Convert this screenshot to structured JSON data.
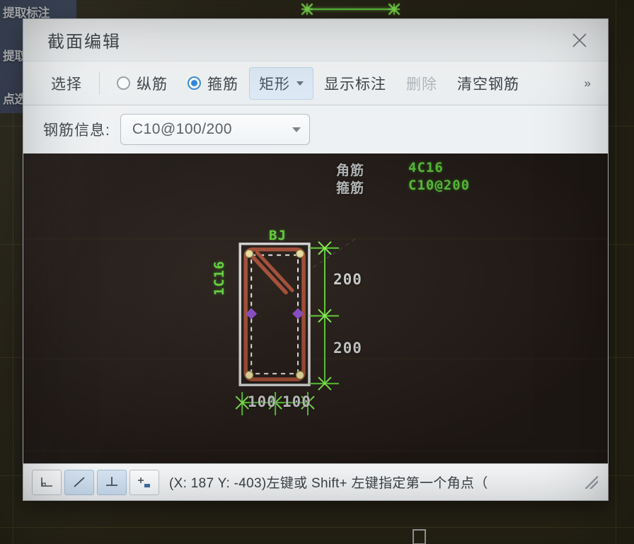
{
  "window": {
    "title": "截面编辑",
    "close_icon": "close-icon"
  },
  "toolbar": {
    "select_label": "选择",
    "radio_longitudinal": "纵筋",
    "radio_stirrup": "箍筋",
    "shape_label": "矩形",
    "show_annotation_label": "显示标注",
    "delete_label": "删除",
    "clear_rebar_label": "清空钢筋",
    "overflow_label": "»"
  },
  "property": {
    "rebar_info_label": "钢筋信息:",
    "rebar_info_value": "C10@100/200"
  },
  "canvas": {
    "legend": [
      {
        "name": "角筋",
        "value": "4C16"
      },
      {
        "name": "箍筋",
        "value": "C10@200"
      }
    ],
    "section_top_label": "BJ",
    "section_side_label": "1C16",
    "dim_vertical": [
      "200",
      "200"
    ],
    "dim_horizontal": [
      "100",
      "100"
    ],
    "colors": {
      "background": "#251d19",
      "annotation_green": "#63d53c",
      "dimension_text": "#cfd2d3",
      "rebar_outline": "#a24b35",
      "section_border": "#d8dadb",
      "corner_bar": "#e8dda0",
      "mid_marker": "#8a4bc8"
    }
  },
  "statusbar": {
    "snap_tools": [
      {
        "icon": "snap-endpoint-icon",
        "active": false
      },
      {
        "icon": "snap-line-icon",
        "active": true
      },
      {
        "icon": "snap-perpendicular-icon",
        "active": true
      },
      {
        "icon": "snap-midpoint-icon",
        "active": false
      }
    ],
    "message": "(X: 187 Y: -403)左键或 Shift+ 左键指定第一个角点（",
    "resize_grip_icon": "resize-grip-icon"
  },
  "background": {
    "menu_items": [
      "提取标注",
      "提取",
      "点选"
    ]
  }
}
